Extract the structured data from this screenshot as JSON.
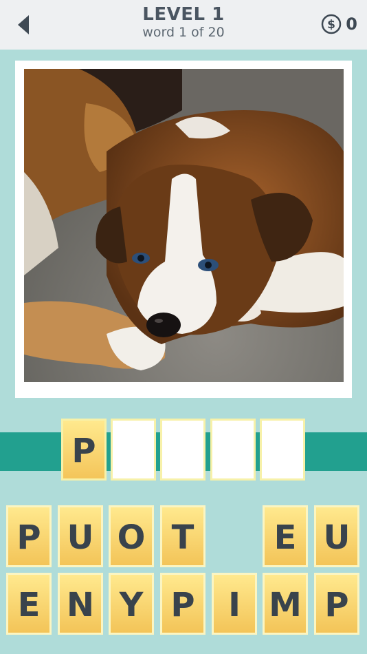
{
  "header": {
    "level_title": "LEVEL 1",
    "word_progress": "word 1 of 20",
    "coin_count": "0",
    "back_icon": "back-arrow-icon",
    "coin_icon": "dollar-coin-icon"
  },
  "puzzle": {
    "image_subject": "puppy",
    "answer_slots": [
      "P",
      "",
      "",
      "",
      ""
    ]
  },
  "letter_tiles": {
    "row1": [
      "P",
      "U",
      "O",
      "T",
      "",
      "E",
      "U"
    ],
    "row2": [
      "E",
      "N",
      "Y",
      "P",
      "I",
      "M",
      "P"
    ]
  },
  "colors": {
    "background": "#afdcd9",
    "header": "#eef0f2",
    "band": "#22a08f",
    "tile": "#f7d772",
    "text": "#39434c"
  }
}
